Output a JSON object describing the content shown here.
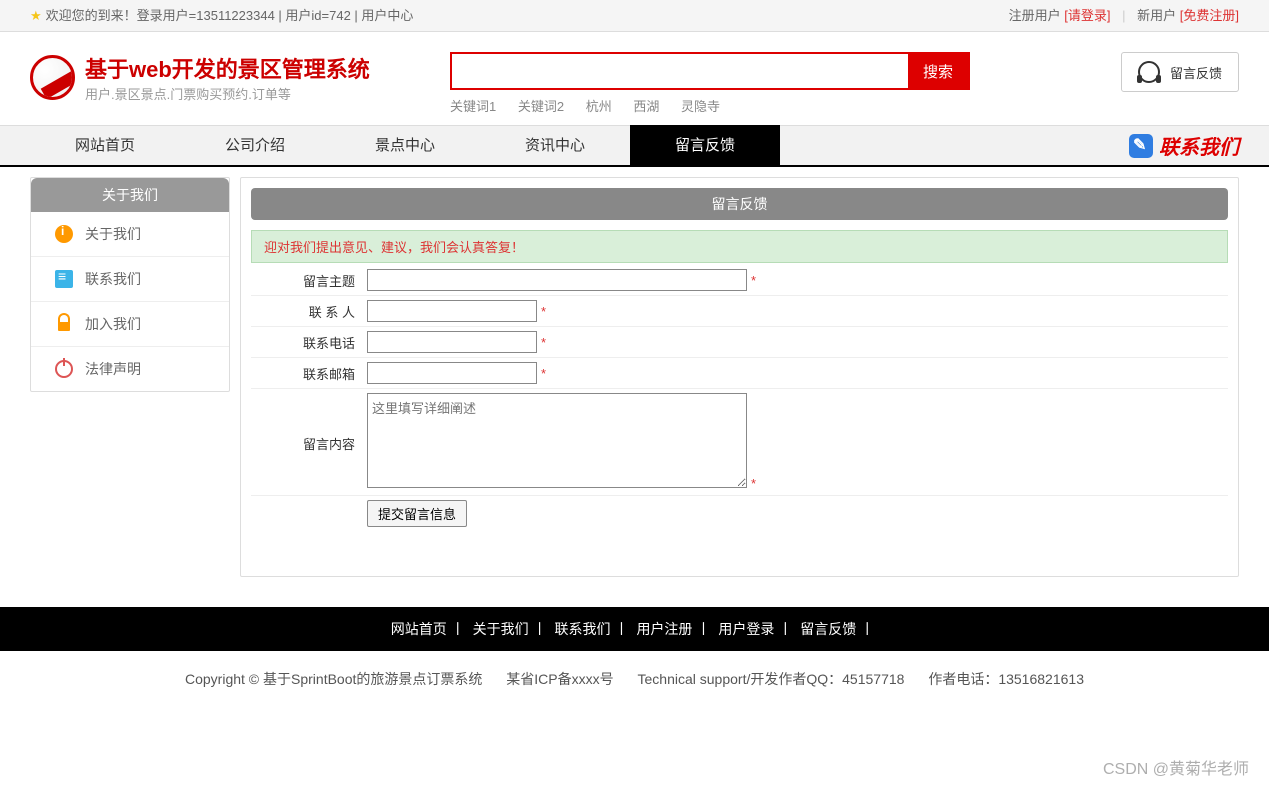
{
  "topbar": {
    "welcome": "欢迎您的到来！登录用户=13511223344 | 用户id=742 | 用户中心",
    "reg_label": "注册用户",
    "login_link": "[请登录]",
    "new_label": "新用户",
    "reg_link": "[免费注册]"
  },
  "logo": {
    "title": "基于web开发的景区管理系统",
    "subtitle": "用户.景区景点.门票购买预约.订单等"
  },
  "search": {
    "button": "搜索",
    "keywords": [
      "关键词1",
      "关键词2",
      "杭州",
      "西湖",
      "灵隐寺"
    ]
  },
  "feedback_btn": "留言反馈",
  "nav": {
    "items": [
      "网站首页",
      "公司介绍",
      "景点中心",
      "资讯中心",
      "留言反馈"
    ],
    "active_index": 4,
    "contact": "联系我们"
  },
  "sidebar": {
    "title": "关于我们",
    "items": [
      {
        "label": "关于我们",
        "icon": "info"
      },
      {
        "label": "联系我们",
        "icon": "clipboard"
      },
      {
        "label": "加入我们",
        "icon": "lock"
      },
      {
        "label": "法律声明",
        "icon": "power"
      }
    ]
  },
  "content": {
    "title": "留言反馈",
    "notice": "迎对我们提出意见、建议，我们会认真答复！",
    "fields": {
      "subject": "留言主题",
      "contact": "联 系 人",
      "phone": "联系电话",
      "email": "联系邮箱",
      "body": "留言内容"
    },
    "textarea_placeholder": "这里填写详细阐述",
    "submit": "提交留言信息"
  },
  "footer_nav": [
    "网站首页",
    "关于我们",
    "联系我们",
    "用户注册",
    "用户登录",
    "留言反馈"
  ],
  "copyright": {
    "text": "Copyright © 基于SprintBoot的旅游景点订票系统",
    "icp": "某省ICP备xxxx号",
    "support": "Technical support/开发作者QQ：45157718",
    "phone": "作者电话：13516821613"
  },
  "watermark": "CSDN @黄菊华老师"
}
